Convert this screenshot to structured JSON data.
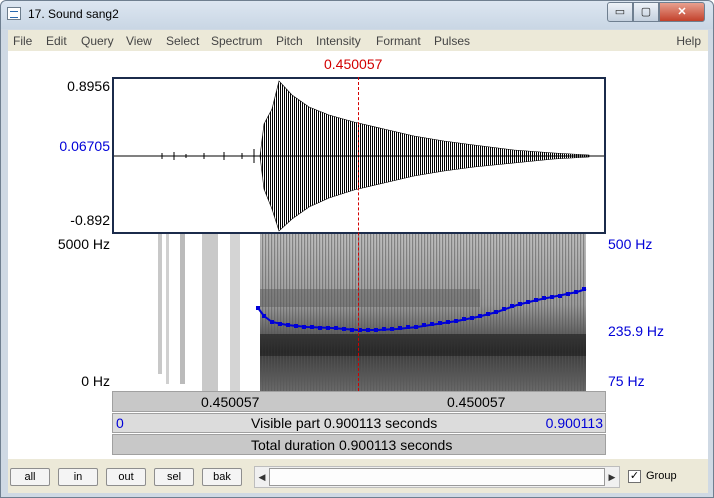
{
  "window": {
    "title": "17. Sound sang2",
    "minimize": "▭",
    "maximize": "▢",
    "close": "✕"
  },
  "menu": [
    "File",
    "Edit",
    "Query",
    "View",
    "Select",
    "Spectrum",
    "Pitch",
    "Intensity",
    "Formant",
    "Pulses"
  ],
  "menu_help": "Help",
  "cursor_time": "0.450057",
  "waveform": {
    "max": "0.8956",
    "cursor_value": "0.06705",
    "min": "-0.892"
  },
  "spectrogram": {
    "top": "5000 Hz",
    "bottom": "0 Hz"
  },
  "pitch": {
    "top": "500 Hz",
    "cursor_value": "235.9 Hz",
    "bottom": "75 Hz"
  },
  "bars": {
    "left_time": "0.450057",
    "right_time": "0.450057",
    "visible_start": "0",
    "visible_label": "Visible part 0.900113 seconds",
    "visible_end": "0.900113",
    "total_label": "Total duration 0.900113 seconds"
  },
  "buttons": {
    "all": "all",
    "in": "in",
    "out": "out",
    "sel": "sel",
    "bak": "bak"
  },
  "scroll": {
    "left": "◀",
    "right": "▶"
  },
  "group": {
    "label": "Group",
    "checked": "✓"
  },
  "colors": {
    "cursor": "#d20000",
    "pitch": "#0000d8"
  }
}
